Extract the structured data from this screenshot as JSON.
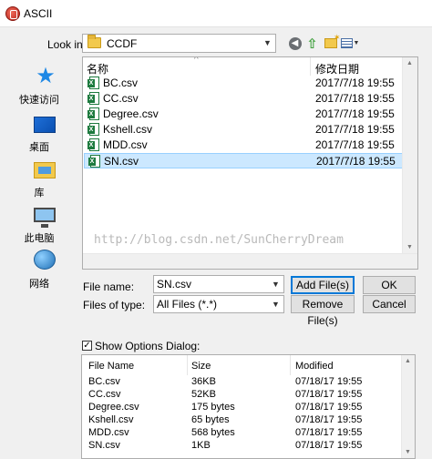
{
  "window": {
    "title": "ASCII"
  },
  "lookin": {
    "label": "Look in:",
    "value": "CCDF"
  },
  "places": [
    {
      "label": "快速访问",
      "icon": "star-icon"
    },
    {
      "label": "桌面",
      "icon": "desktop-icon"
    },
    {
      "label": "库",
      "icon": "library-icon"
    },
    {
      "label": "此电脑",
      "icon": "computer-icon"
    },
    {
      "label": "网络",
      "icon": "network-icon"
    }
  ],
  "filelist": {
    "col_name": "名称",
    "col_date": "修改日期",
    "files": [
      {
        "name": "BC.csv",
        "date": "2017/7/18 19:55"
      },
      {
        "name": "CC.csv",
        "date": "2017/7/18 19:55"
      },
      {
        "name": "Degree.csv",
        "date": "2017/7/18 19:55"
      },
      {
        "name": "Kshell.csv",
        "date": "2017/7/18 19:55"
      },
      {
        "name": "MDD.csv",
        "date": "2017/7/18 19:55"
      },
      {
        "name": "SN.csv",
        "date": "2017/7/18 19:55"
      }
    ],
    "selected_index": 5,
    "watermark": "http://blog.csdn.net/SunCherryDream"
  },
  "form": {
    "filename_label": "File name:",
    "filename_value": "SN.csv",
    "filetype_label": "Files of type:",
    "filetype_value": "All Files (*.*)",
    "add_label": "Add File(s)",
    "remove_label": "Remove File(s)",
    "ok_label": "OK",
    "cancel_label": "Cancel"
  },
  "options": {
    "checkbox_label": "Show Options Dialog:",
    "checked": true,
    "col_name": "File Name",
    "col_size": "Size",
    "col_modified": "Modified",
    "rows": [
      {
        "name": "BC.csv",
        "size": "36KB",
        "modified": "07/18/17 19:55"
      },
      {
        "name": "CC.csv",
        "size": "52KB",
        "modified": "07/18/17 19:55"
      },
      {
        "name": "Degree.csv",
        "size": "175 bytes",
        "modified": "07/18/17 19:55"
      },
      {
        "name": "Kshell.csv",
        "size": "65 bytes",
        "modified": "07/18/17 19:55"
      },
      {
        "name": "MDD.csv",
        "size": "568 bytes",
        "modified": "07/18/17 19:55"
      },
      {
        "name": "SN.csv",
        "size": "1KB",
        "modified": "07/18/17 19:55"
      }
    ]
  }
}
